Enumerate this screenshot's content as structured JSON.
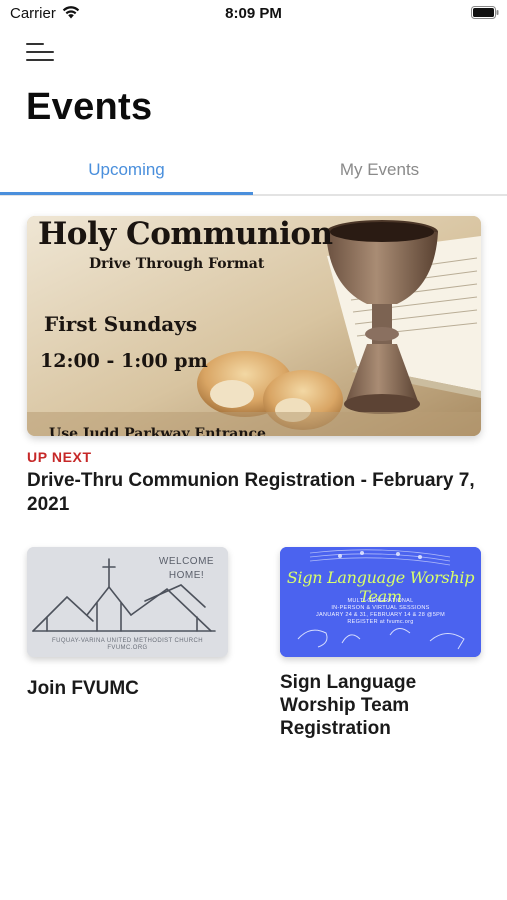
{
  "status_bar": {
    "carrier": "Carrier",
    "time": "8:09 PM"
  },
  "header": {
    "title": "Events"
  },
  "tabs": [
    {
      "label": "Upcoming",
      "active": true
    },
    {
      "label": "My Events",
      "active": false
    }
  ],
  "featured": {
    "badge": "UP NEXT",
    "title": "Drive-Thru Communion Registration - February 7, 2021",
    "image_text": {
      "title": "Holy Communion",
      "subtitle": "Drive Through Format",
      "when": "First Sundays",
      "hours": "12:00 - 1:00 pm",
      "note": "Use Judd Parkway Entrance"
    }
  },
  "cards": [
    {
      "title": "Join FVUMC",
      "image_text": {
        "welcome": "WELCOME HOME!",
        "church": "FUQUAY-VARINA UNITED METHODIST CHURCH",
        "site": "FVUMC.ORG"
      }
    },
    {
      "title": "Sign Language Worship Team Registration",
      "image_text": {
        "title": "Sign Language Worship Team",
        "line1": "MULTI-GENERATIONAL",
        "line2": "IN-PERSON & VIRTUAL SESSIONS",
        "line3": "JANUARY 24 & 31, FEBRUARY 14 & 28 @5PM",
        "line4": "REGISTER at fvumc.org"
      }
    }
  ],
  "colors": {
    "accent": "#4a8fdc",
    "up_next": "#c62828",
    "sign_card_bg": "#4b63ef",
    "join_card_bg": "#d9dbe0"
  }
}
